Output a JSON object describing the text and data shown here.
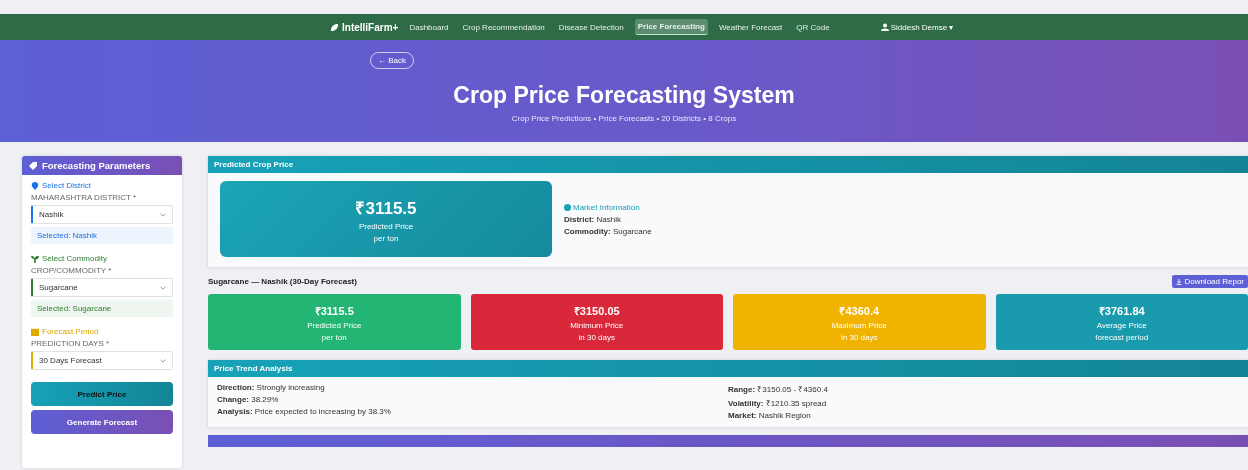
{
  "nav": {
    "brand": "IntelliFarm+",
    "items": [
      {
        "label": "Dashboard",
        "selected": false
      },
      {
        "label": "Crop Recommendation",
        "selected": false
      },
      {
        "label": "Disease Detection",
        "selected": false
      },
      {
        "label": "Price Forecasting",
        "selected": true
      },
      {
        "label": "Weather Forecast",
        "selected": false
      },
      {
        "label": "QR Code",
        "selected": false
      }
    ],
    "user": "Siddesh Demse ▾"
  },
  "hero": {
    "back": "← Back",
    "title": "Crop Price Forecasting System",
    "subtitle": "Crop Price Predictions • Price Forecasts • 20 Districts • 8 Crops"
  },
  "sidebar": {
    "title": "Forecasting Parameters",
    "sections": [
      {
        "heading": "Select District",
        "color": "#1a73e8",
        "label": "MAHARASHTRA DISTRICT *",
        "value": "Nashik",
        "note": "Selected: Nashik"
      },
      {
        "heading": "Select Commodity",
        "color": "#2e7d32",
        "label": "CROP/COMMODITY *",
        "value": "Sugarcane",
        "note": "Selected: Sugarcane"
      },
      {
        "heading": "Forecast Period",
        "color": "#e0a800",
        "label": "PREDICTION DAYS *",
        "value": "30 Days Forecast"
      }
    ],
    "buttons": [
      {
        "label": "Predict Price",
        "kind": "teal"
      },
      {
        "label": "Generate Forecast",
        "kind": "purple"
      }
    ]
  },
  "predicted": {
    "header": "Predicted Crop Price",
    "price": "₹3115.5",
    "label": "Predicted Price",
    "unit": "per ton",
    "info_heading": "Market Information",
    "info": [
      "**District:** Nashik",
      "**Commodity:** Sugarcane"
    ]
  },
  "forecast": {
    "title": "Sugarcane — Nashik (30-Day Forecast)",
    "download": "Download Repor",
    "stats": [
      {
        "value": "₹3115.5",
        "label": "Predicted Price",
        "sub": "per ton",
        "color": "#22b573"
      },
      {
        "value": "₹3150.05",
        "label": "Minimum Price",
        "sub": "in 30 days",
        "color": "#d9283a"
      },
      {
        "value": "₹4360.4",
        "label": "Maximum Price",
        "sub": "in 30 days",
        "color": "#f0b400"
      },
      {
        "value": "₹3761.84",
        "label": "Average Price",
        "sub": "forecast period",
        "color": "#1a9bad"
      }
    ]
  },
  "trend": {
    "header": "Price Trend Analysis",
    "left": [
      "**Direction:** Strongly increasing",
      "**Change:** 38.29%",
      "**Analysis:** Price expected to increasing by 38.3%"
    ],
    "right": [
      "**Range:** ₹3150.05 - ₹4360.4",
      "**Volatility:** ₹1210.35 spread",
      "**Market:** Nashik Region"
    ]
  }
}
